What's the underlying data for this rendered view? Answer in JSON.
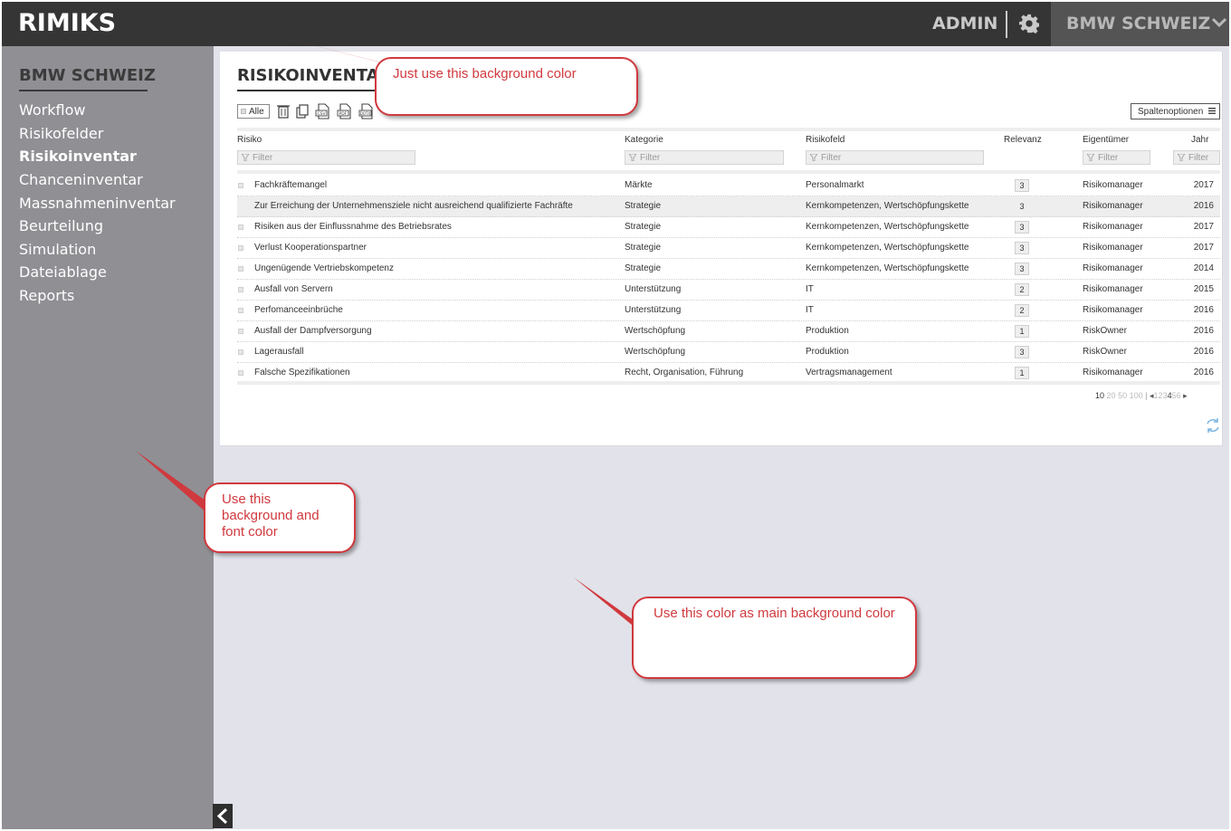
{
  "app": {
    "logo": "RIMIKS"
  },
  "header": {
    "user": "ADMIN",
    "client": "BMW SCHWEIZ",
    "settings_icon": "gear-icon",
    "client_dropdown_icon": "chevron-down-icon"
  },
  "sidebar": {
    "title": "BMW SCHWEIZ",
    "items": [
      {
        "label": "Workflow",
        "active": false
      },
      {
        "label": "Risikofelder",
        "active": false
      },
      {
        "label": "Risikoinventar",
        "active": true
      },
      {
        "label": "Chanceninventar",
        "active": false
      },
      {
        "label": "Massnahmeninventar",
        "active": false
      },
      {
        "label": "Beurteilung",
        "active": false
      },
      {
        "label": "Simulation",
        "active": false
      },
      {
        "label": "Dateiablage",
        "active": false
      },
      {
        "label": "Reports",
        "active": false
      }
    ],
    "collapse_icon": "chevron-left-icon"
  },
  "main": {
    "title": "RISIKOINVENTAR",
    "toolbar": {
      "select_all": "Alle",
      "icons": [
        "trash-icon",
        "copy-icon",
        "export-csv-icon",
        "export-pdf-icon",
        "export-docx-icon"
      ],
      "column_options": "Spaltenoptionen"
    },
    "table": {
      "headers": {
        "risiko": "Risiko",
        "kategorie": "Kategorie",
        "risikofeld": "Risikofeld",
        "relevanz": "Relevanz",
        "eigentuemer": "Eigentümer",
        "jahr": "Jahr"
      },
      "filter_placeholder": "Filter",
      "rows": [
        {
          "risiko": "Fachkräftemangel",
          "kategorie": "Märkte",
          "risikofeld": "Personalmarkt",
          "relevanz": "3",
          "eigentuemer": "Risikomanager",
          "jahr": "2017"
        },
        {
          "risiko": "Zur Erreichung der Unternehmensziele nicht ausreichend qualifizierte Fachräfte",
          "kategorie": "Strategie",
          "risikofeld": "Kernkompetenzen, Wertschöpfungskette",
          "relevanz": "3",
          "eigentuemer": "Risikomanager",
          "jahr": "2016"
        },
        {
          "risiko": "Risiken aus der Einflussnahme des Betriebsrates",
          "kategorie": "Strategie",
          "risikofeld": "Kernkompetenzen, Wertschöpfungskette",
          "relevanz": "3",
          "eigentuemer": "Risikomanager",
          "jahr": "2017"
        },
        {
          "risiko": "Verlust Kooperationspartner",
          "kategorie": "Strategie",
          "risikofeld": "Kernkompetenzen, Wertschöpfungskette",
          "relevanz": "3",
          "eigentuemer": "Risikomanager",
          "jahr": "2017"
        },
        {
          "risiko": "Ungenügende Vertriebskompetenz",
          "kategorie": "Strategie",
          "risikofeld": "Kernkompetenzen, Wertschöpfungskette",
          "relevanz": "3",
          "eigentuemer": "Risikomanager",
          "jahr": "2014"
        },
        {
          "risiko": "Ausfall von Servern",
          "kategorie": "Unterstützung",
          "risikofeld": "IT",
          "relevanz": "2",
          "eigentuemer": "Risikomanager",
          "jahr": "2015"
        },
        {
          "risiko": "Perfomanceeinbrüche",
          "kategorie": "Unterstützung",
          "risikofeld": "IT",
          "relevanz": "2",
          "eigentuemer": "Risikomanager",
          "jahr": "2016"
        },
        {
          "risiko": "Ausfall der Dampfversorgung",
          "kategorie": "Wertschöpfung",
          "risikofeld": "Produktion",
          "relevanz": "1",
          "eigentuemer": "RiskOwner",
          "jahr": "2016"
        },
        {
          "risiko": "Lagerausfall",
          "kategorie": "Wertschöpfung",
          "risikofeld": "Produktion",
          "relevanz": "3",
          "eigentuemer": "RiskOwner",
          "jahr": "2016"
        },
        {
          "risiko": "Falsche Spezifikationen",
          "kategorie": "Recht, Organisation, Führung",
          "risikofeld": "Vertragsmanagement",
          "relevanz": "1",
          "eigentuemer": "Risikomanager",
          "jahr": "2016"
        }
      ]
    },
    "pager": {
      "page_sizes": [
        "10",
        "20",
        "50",
        "100"
      ],
      "selected_size": "10",
      "pages": [
        "1",
        "2",
        "3",
        "4",
        "5",
        "6"
      ],
      "current_page": "4",
      "prev": "◂",
      "next": "▸"
    },
    "refresh_icon": "refresh-icon"
  },
  "annotations": [
    {
      "text": "Just use this background color"
    },
    {
      "text": "Use this background and font color"
    },
    {
      "text": "Use this color as main background color"
    }
  ],
  "colors": {
    "header_bg": "#353535",
    "header_client_bg": "#545454",
    "sidebar_bg": "#8f8f94",
    "main_bg": "#e2e2ea",
    "card_bg": "#ffffff",
    "annotation": "#d0393e"
  }
}
